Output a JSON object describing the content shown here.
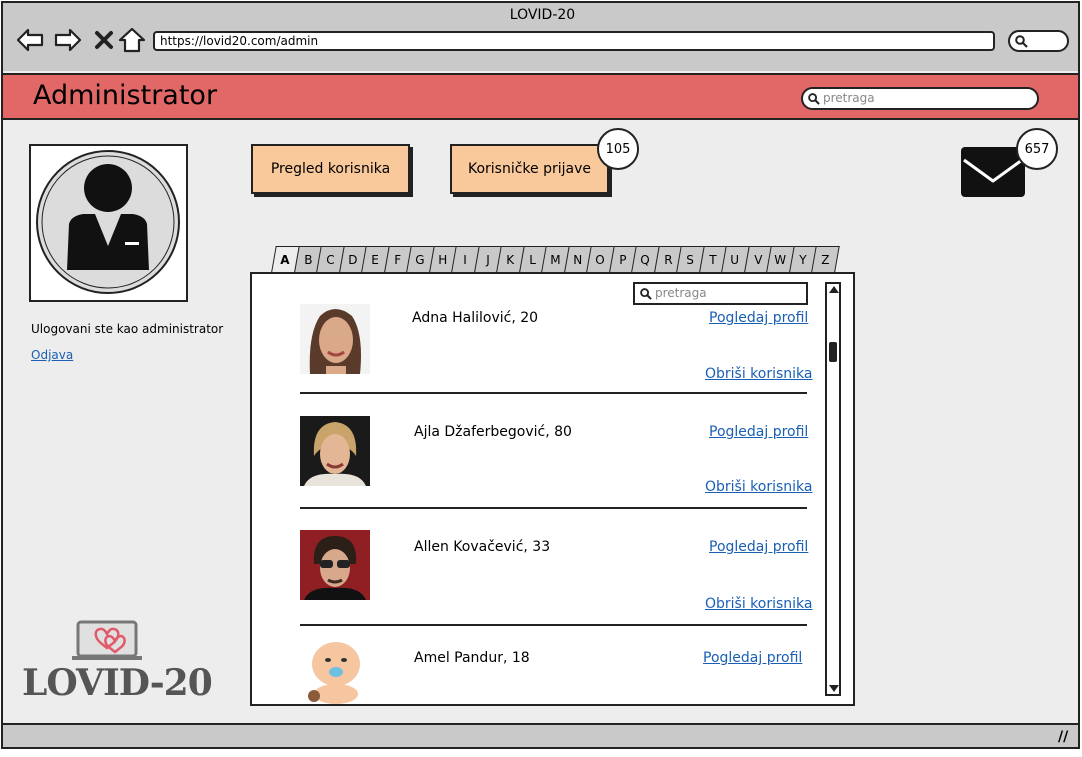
{
  "browser": {
    "window_title": "LOVID-20",
    "url": "https://lovid20.com/admin",
    "nav_icons": [
      "back-icon",
      "forward-icon",
      "close-icon",
      "home-icon"
    ]
  },
  "header": {
    "title": "Administrator",
    "search_placeholder": "pretraga",
    "accent_color": "#e26868"
  },
  "sidebar": {
    "logged_in_text": "Ulogovani ste kao administrator",
    "logout_label": "Odjava",
    "logo_text": "LOVID-20"
  },
  "toolbar": {
    "users_button_label": "Pregled korisnika",
    "reports_button_label": "Korisničke prijave",
    "reports_count": "105",
    "mail_count": "657",
    "button_color": "#f9c89b"
  },
  "alphabet_tabs": [
    "A",
    "B",
    "C",
    "D",
    "E",
    "F",
    "G",
    "H",
    "I",
    "J",
    "K",
    "L",
    "M",
    "N",
    "O",
    "P",
    "Q",
    "R",
    "S",
    "T",
    "U",
    "V",
    "W",
    "Y",
    "Z"
  ],
  "active_tab": "A",
  "user_list": {
    "search_placeholder": "pretraga",
    "users": [
      {
        "name": "Adna Halilović, 20",
        "view_label": "Pogledaj profil",
        "delete_label": "Obriši korisnika"
      },
      {
        "name": "Ajla Džaferbegović, 80",
        "view_label": "Pogledaj profil",
        "delete_label": "Obriši korisnika"
      },
      {
        "name": "Allen Kovačević, 33",
        "view_label": "Pogledaj profil",
        "delete_label": "Obriši korisnika"
      },
      {
        "name": "Amel Pandur, 18",
        "view_label": "Pogledaj profil"
      }
    ]
  }
}
